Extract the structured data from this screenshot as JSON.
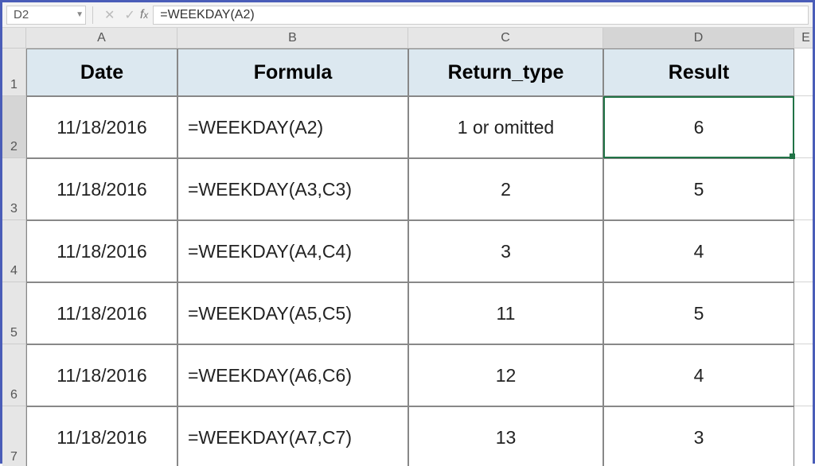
{
  "nameBox": "D2",
  "formulaBar": "=WEEKDAY(A2)",
  "columns": [
    "A",
    "B",
    "C",
    "D",
    "E"
  ],
  "rows": [
    "1",
    "2",
    "3",
    "4",
    "5",
    "6",
    "7"
  ],
  "header": {
    "A": "Date",
    "B": "Formula",
    "C": "Return_type",
    "D": "Result"
  },
  "data": [
    {
      "date": "11/18/2016",
      "formula": "=WEEKDAY(A2)",
      "rtype": "1 or omitted",
      "result": "6"
    },
    {
      "date": "11/18/2016",
      "formula": "=WEEKDAY(A3,C3)",
      "rtype": "2",
      "result": "5"
    },
    {
      "date": "11/18/2016",
      "formula": "=WEEKDAY(A4,C4)",
      "rtype": "3",
      "result": "4"
    },
    {
      "date": "11/18/2016",
      "formula": "=WEEKDAY(A5,C5)",
      "rtype": "11",
      "result": "5"
    },
    {
      "date": "11/18/2016",
      "formula": "=WEEKDAY(A6,C6)",
      "rtype": "12",
      "result": "4"
    },
    {
      "date": "11/18/2016",
      "formula": "=WEEKDAY(A7,C7)",
      "rtype": "13",
      "result": "3"
    }
  ],
  "activeCell": "D2"
}
